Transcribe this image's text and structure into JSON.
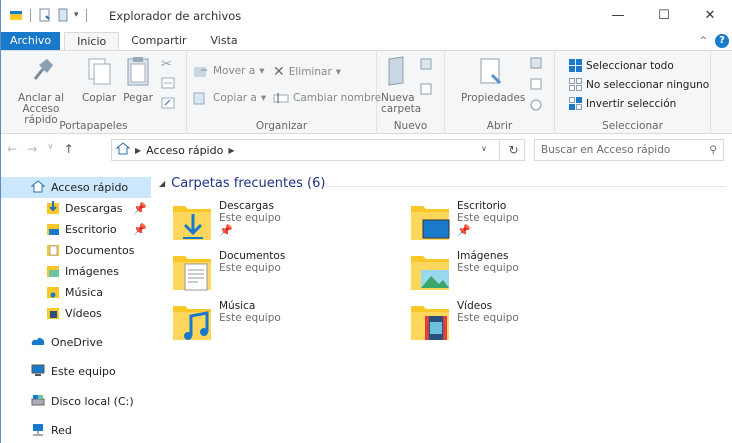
{
  "window": {
    "title": "Explorador de archivos",
    "caption": {
      "minimize": "—",
      "maximize": "☐",
      "close": "✕"
    }
  },
  "ribbon": {
    "tabs": [
      "Archivo",
      "Inicio",
      "Compartir",
      "Vista"
    ],
    "portapapeles": {
      "label": "Portapapeles",
      "pin": "Anclar al\nAcceso rápido",
      "pin_line1": "Anclar al",
      "pin_line2": "Acceso rápido",
      "copy": "Copiar",
      "paste": "Pegar"
    },
    "organizar": {
      "label": "Organizar",
      "move": "Mover a",
      "copy_to": "Copiar a",
      "delete": "Eliminar",
      "rename": "Cambiar nombre"
    },
    "nuevo": {
      "label": "Nuevo",
      "new_line1": "Nueva",
      "new_line2": "carpeta"
    },
    "abrir": {
      "label": "Abrir",
      "props": "Propiedades"
    },
    "seleccionar": {
      "label": "Seleccionar",
      "all": "Seleccionar todo",
      "none": "No seleccionar ninguno",
      "invert": "Invertir selección"
    }
  },
  "address": {
    "path": "Acceso rápido",
    "search_placeholder": "Buscar en Acceso rápido"
  },
  "navpane": {
    "items": [
      {
        "label": "Acceso rápido"
      },
      {
        "label": "Descargas"
      },
      {
        "label": "Escritorio"
      },
      {
        "label": "Documentos"
      },
      {
        "label": "Imágenes"
      },
      {
        "label": "Música"
      },
      {
        "label": "Vídeos"
      },
      {
        "label": "OneDrive"
      },
      {
        "label": "Este equipo"
      },
      {
        "label": "Disco local (C:)"
      },
      {
        "label": "Red"
      }
    ]
  },
  "content": {
    "section": "Carpetas frecuentes (6)",
    "folders": [
      {
        "name": "Descargas",
        "sub": "Este equipo"
      },
      {
        "name": "Escritorio",
        "sub": "Este equipo"
      },
      {
        "name": "Documentos",
        "sub": "Este equipo"
      },
      {
        "name": "Imágenes",
        "sub": "Este equipo"
      },
      {
        "name": "Música",
        "sub": "Este equipo"
      },
      {
        "name": "Vídeos",
        "sub": "Este equipo"
      }
    ]
  },
  "colors": {
    "accent": "#1979ca",
    "folder": "#f8c829",
    "selected": "#cce8ff",
    "section": "#1e3287"
  }
}
